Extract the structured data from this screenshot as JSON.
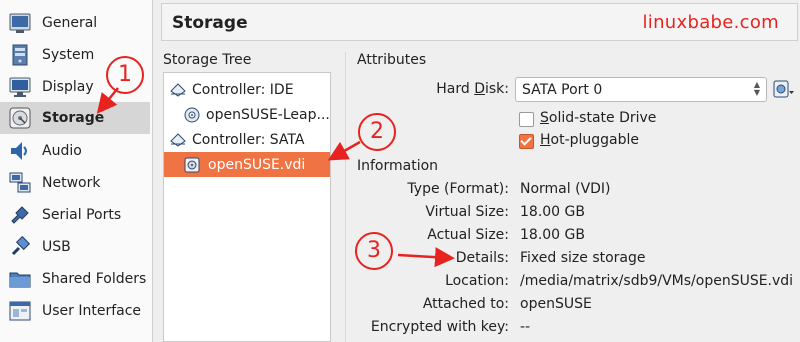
{
  "sidebar": {
    "items": [
      {
        "label": "General",
        "icon": "general-icon"
      },
      {
        "label": "System",
        "icon": "system-icon"
      },
      {
        "label": "Display",
        "icon": "display-icon"
      },
      {
        "label": "Storage",
        "icon": "storage-icon",
        "active": true
      },
      {
        "label": "Audio",
        "icon": "audio-icon"
      },
      {
        "label": "Network",
        "icon": "network-icon"
      },
      {
        "label": "Serial Ports",
        "icon": "serial-ports-icon"
      },
      {
        "label": "USB",
        "icon": "usb-icon"
      },
      {
        "label": "Shared Folders",
        "icon": "shared-folders-icon"
      },
      {
        "label": "User Interface",
        "icon": "user-interface-icon"
      }
    ]
  },
  "header": {
    "title": "Storage",
    "watermark": "linuxbabe.com"
  },
  "storage_tree": {
    "title": "Storage Tree",
    "rows": [
      {
        "label": "Controller: IDE",
        "icon": "ide-controller-icon"
      },
      {
        "label": "openSUSE-Leap...",
        "icon": "optical-disc-icon"
      },
      {
        "label": "Controller: SATA",
        "icon": "sata-controller-icon"
      },
      {
        "label": "openSUSE.vdi",
        "icon": "hard-disk-icon",
        "selected": true
      }
    ]
  },
  "attributes": {
    "title": "Attributes",
    "hard_disk_label_pre": "Hard ",
    "hard_disk_label_u": "D",
    "hard_disk_label_post": "isk:",
    "hard_disk_value": "SATA Port 0",
    "solid_state_u": "S",
    "solid_state_rest": "olid-state Drive",
    "solid_state_checked": false,
    "hot_pluggable_u": "H",
    "hot_pluggable_rest": "ot-pluggable",
    "hot_pluggable_checked": true
  },
  "information": {
    "title": "Information",
    "rows": [
      {
        "label": "Type (Format):",
        "value": "Normal (VDI)"
      },
      {
        "label": "Virtual Size:",
        "value": "18.00 GB"
      },
      {
        "label": "Actual Size:",
        "value": "18.00 GB"
      },
      {
        "label": "Details:",
        "value": "Fixed size storage"
      },
      {
        "label": "Location:",
        "value": "/media/matrix/sdb9/VMs/openSUSE.vdi"
      },
      {
        "label": "Attached to:",
        "value": "openSUSE"
      },
      {
        "label": "Encrypted with key:",
        "value": "--"
      }
    ]
  },
  "annotations": {
    "one": "1",
    "two": "2",
    "three": "3"
  },
  "colors": {
    "accent": "#ef7343",
    "annotation": "#e8231f"
  }
}
